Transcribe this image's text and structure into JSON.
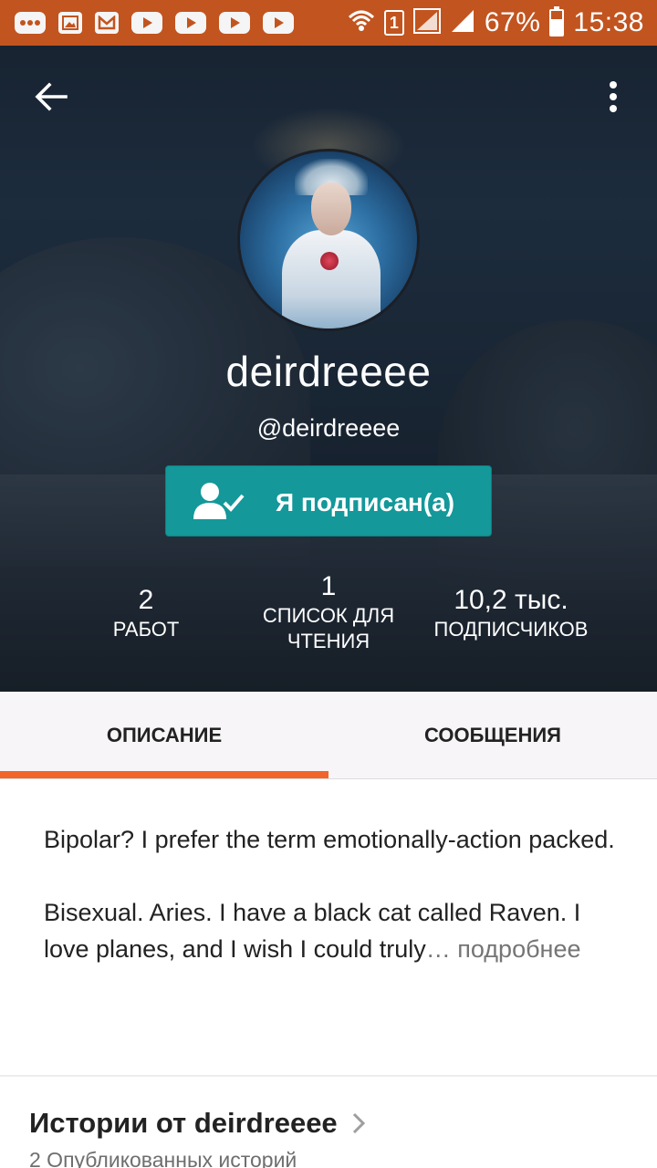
{
  "status_bar": {
    "battery": "67%",
    "time": "15:38",
    "sim": "1",
    "battery_level": 0.67,
    "notification_icons": [
      "chat-icon",
      "gallery-icon",
      "gmail-icon",
      "youtube-icon",
      "youtube-icon",
      "youtube-icon",
      "youtube-icon"
    ]
  },
  "header": {
    "back_icon": "arrow-left-icon",
    "menu_icon": "more-vertical-icon"
  },
  "profile": {
    "display_name": "deirdreeee",
    "handle": "@deirdreeee",
    "follow_button_label": "Я подписан(а)",
    "follow_icon": "user-check-icon"
  },
  "stats": {
    "works": {
      "value": "2",
      "label": "РАБОТ"
    },
    "reading_lists": {
      "value": "1",
      "label_line1": "СПИСОК ДЛЯ",
      "label_line2": "ЧТЕНИЯ"
    },
    "followers": {
      "value": "10,2 тыс.",
      "label": "ПОДПИСЧИКОВ"
    }
  },
  "tabs": [
    {
      "label": "ОПИСАНИЕ",
      "active": true
    },
    {
      "label": "СООБЩЕНИЯ",
      "active": false
    }
  ],
  "description": {
    "paragraph1": "Bipolar? I prefer the term emotionally-action packed.",
    "paragraph2": "Bisexual. Aries. I have a black cat called Raven. I love planes, and I wish I could truly",
    "ellipsis": "…",
    "more_link": "подробнее"
  },
  "stories": {
    "title": "Истории от deirdreeee",
    "subtitle": "2 Опубликованных историй"
  },
  "colors": {
    "status_bar": "#c2541f",
    "follow_button": "#14989a",
    "tab_indicator": "#f1652b"
  }
}
